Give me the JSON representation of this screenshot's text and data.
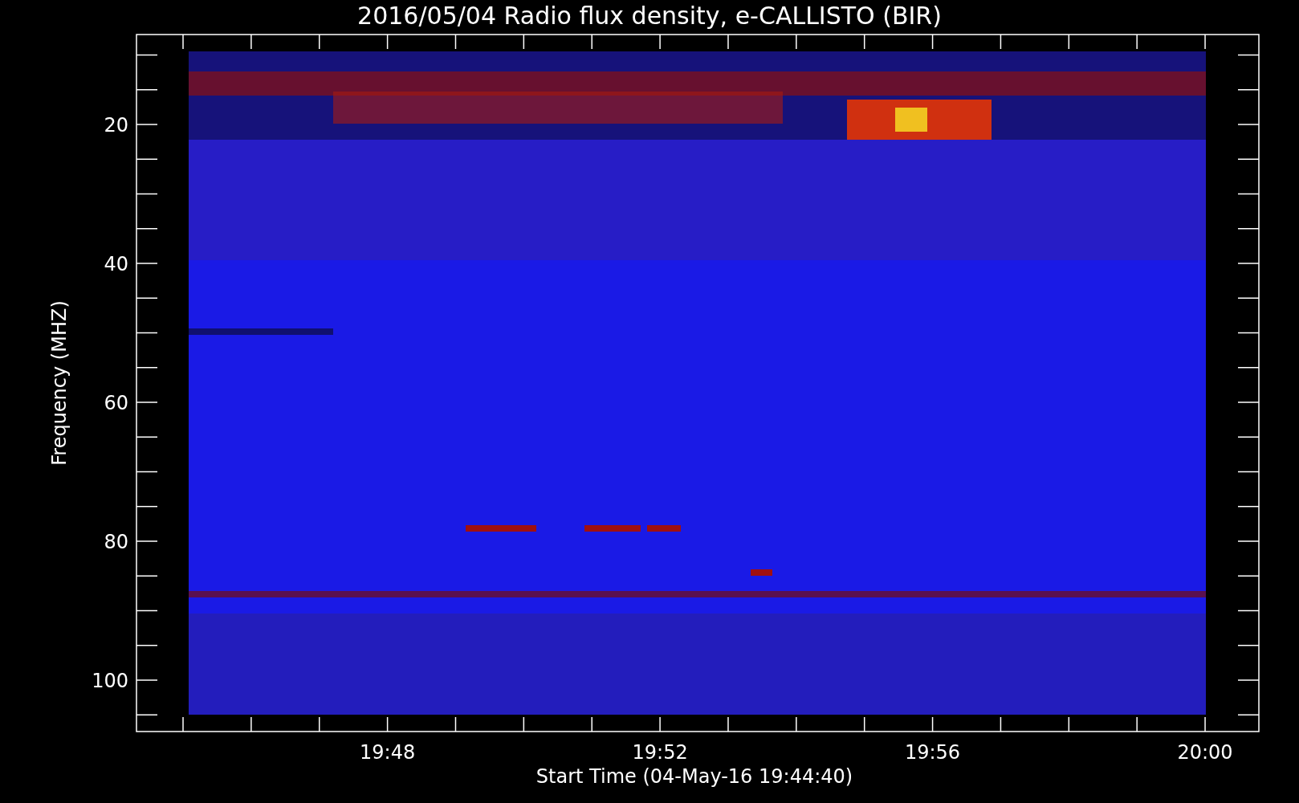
{
  "title": "2016/05/04  Radio flux density, e-CALLISTO (BIR)",
  "y_axis": {
    "label": "Frequency (MHZ)",
    "ticks": [
      "20",
      "40",
      "60",
      "80",
      "100"
    ]
  },
  "x_axis": {
    "label": "Start Time (04-May-16 19:44:40)",
    "ticks": [
      "19:48",
      "19:52",
      "19:56",
      "20:00"
    ]
  }
}
